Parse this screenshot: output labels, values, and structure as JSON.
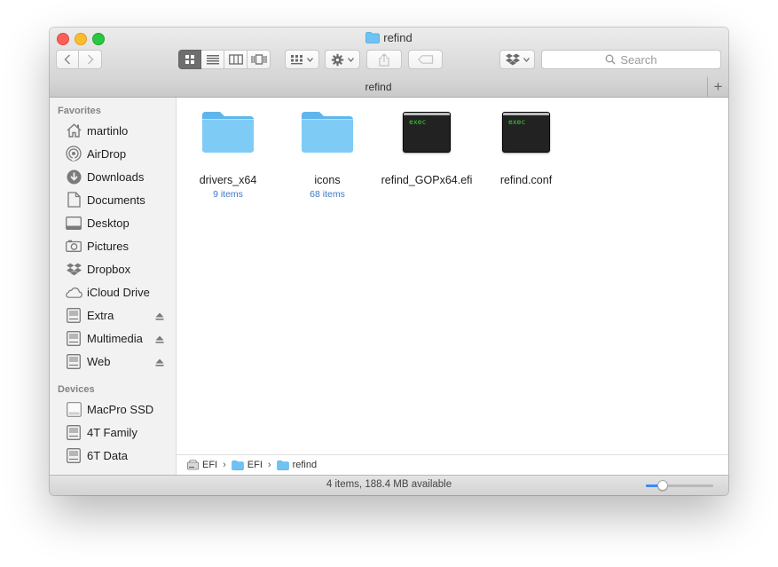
{
  "window": {
    "title": "refind",
    "tab_label": "refind",
    "tab_add_label": "+"
  },
  "toolbar": {
    "back_icon": "chevron-left-icon",
    "forward_icon": "chevron-right-icon",
    "view_modes": [
      "icon-view",
      "list-view",
      "column-view",
      "cover-flow-view"
    ],
    "active_view": "icon-view",
    "search_placeholder": "Search"
  },
  "sidebar": {
    "favorites_title": "Favorites",
    "favorites": [
      {
        "label": "martinlo",
        "icon": "home-icon"
      },
      {
        "label": "AirDrop",
        "icon": "airdrop-icon"
      },
      {
        "label": "Downloads",
        "icon": "downloads-icon"
      },
      {
        "label": "Documents",
        "icon": "documents-icon"
      },
      {
        "label": "Desktop",
        "icon": "desktop-icon"
      },
      {
        "label": "Pictures",
        "icon": "camera-icon"
      },
      {
        "label": "Dropbox",
        "icon": "dropbox-icon"
      },
      {
        "label": "iCloud Drive",
        "icon": "cloud-icon"
      },
      {
        "label": "Extra",
        "icon": "drive-icon",
        "ejectable": true
      },
      {
        "label": "Multimedia",
        "icon": "drive-icon",
        "ejectable": true
      },
      {
        "label": "Web",
        "icon": "drive-icon",
        "ejectable": true
      }
    ],
    "devices_title": "Devices",
    "devices": [
      {
        "label": "MacPro SSD",
        "icon": "internal-drive-icon"
      },
      {
        "label": "4T Family",
        "icon": "drive-icon"
      },
      {
        "label": "6T Data",
        "icon": "drive-icon"
      }
    ]
  },
  "files": [
    {
      "name": "drivers_x64",
      "meta": "9 items",
      "type": "folder"
    },
    {
      "name": "icons",
      "meta": "68 items",
      "type": "folder"
    },
    {
      "name": "refind_GOPx64.efi",
      "meta": "",
      "type": "exec",
      "badge": "exec"
    },
    {
      "name": "refind.conf",
      "meta": "",
      "type": "exec",
      "badge": "exec"
    }
  ],
  "pathbar": {
    "crumbs": [
      "EFI",
      "EFI",
      "refind"
    ]
  },
  "status": {
    "text": "4 items, 188.4 MB available",
    "icon_size_fraction": 0.25
  },
  "colors": {
    "folder": "#6ec3f4",
    "accent": "#3b8af6",
    "close": "#fc5f57",
    "minimize": "#fdbc2e",
    "maximize": "#28c840"
  }
}
